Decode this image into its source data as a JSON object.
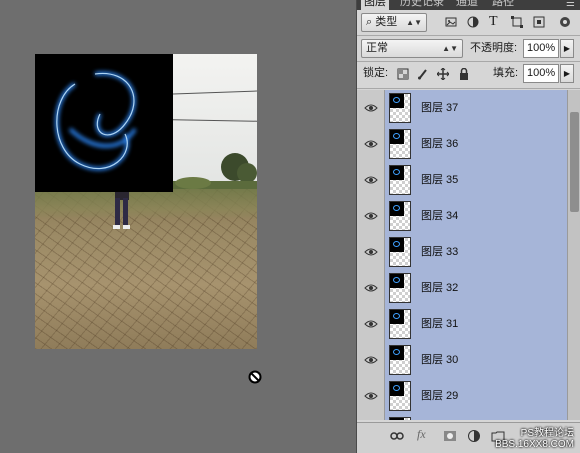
{
  "panel_tabs": [
    {
      "label": "图层"
    },
    {
      "label": "历史记录"
    },
    {
      "label": "通道"
    },
    {
      "label": "路径"
    }
  ],
  "filter": {
    "kind_label": "类型"
  },
  "blend": {
    "mode": "正常",
    "opacity_label": "不透明度:",
    "opacity_value": "100%"
  },
  "lock": {
    "label": "锁定:",
    "fill_label": "填充:",
    "fill_value": "100%"
  },
  "layers": [
    {
      "name": "图层 37"
    },
    {
      "name": "图层 36"
    },
    {
      "name": "图层 35"
    },
    {
      "name": "图层 34"
    },
    {
      "name": "图层 33"
    },
    {
      "name": "图层 32"
    },
    {
      "name": "图层 31"
    },
    {
      "name": "图层 30"
    },
    {
      "name": "图层 29"
    }
  ],
  "watermark": {
    "line1": "PS教程论坛",
    "line2": "BBS.16XX8.COM"
  },
  "colors": {
    "selection": "#a6b5d8",
    "glow": "#2f8cff",
    "canvas_bg": "#6e6e6e"
  }
}
